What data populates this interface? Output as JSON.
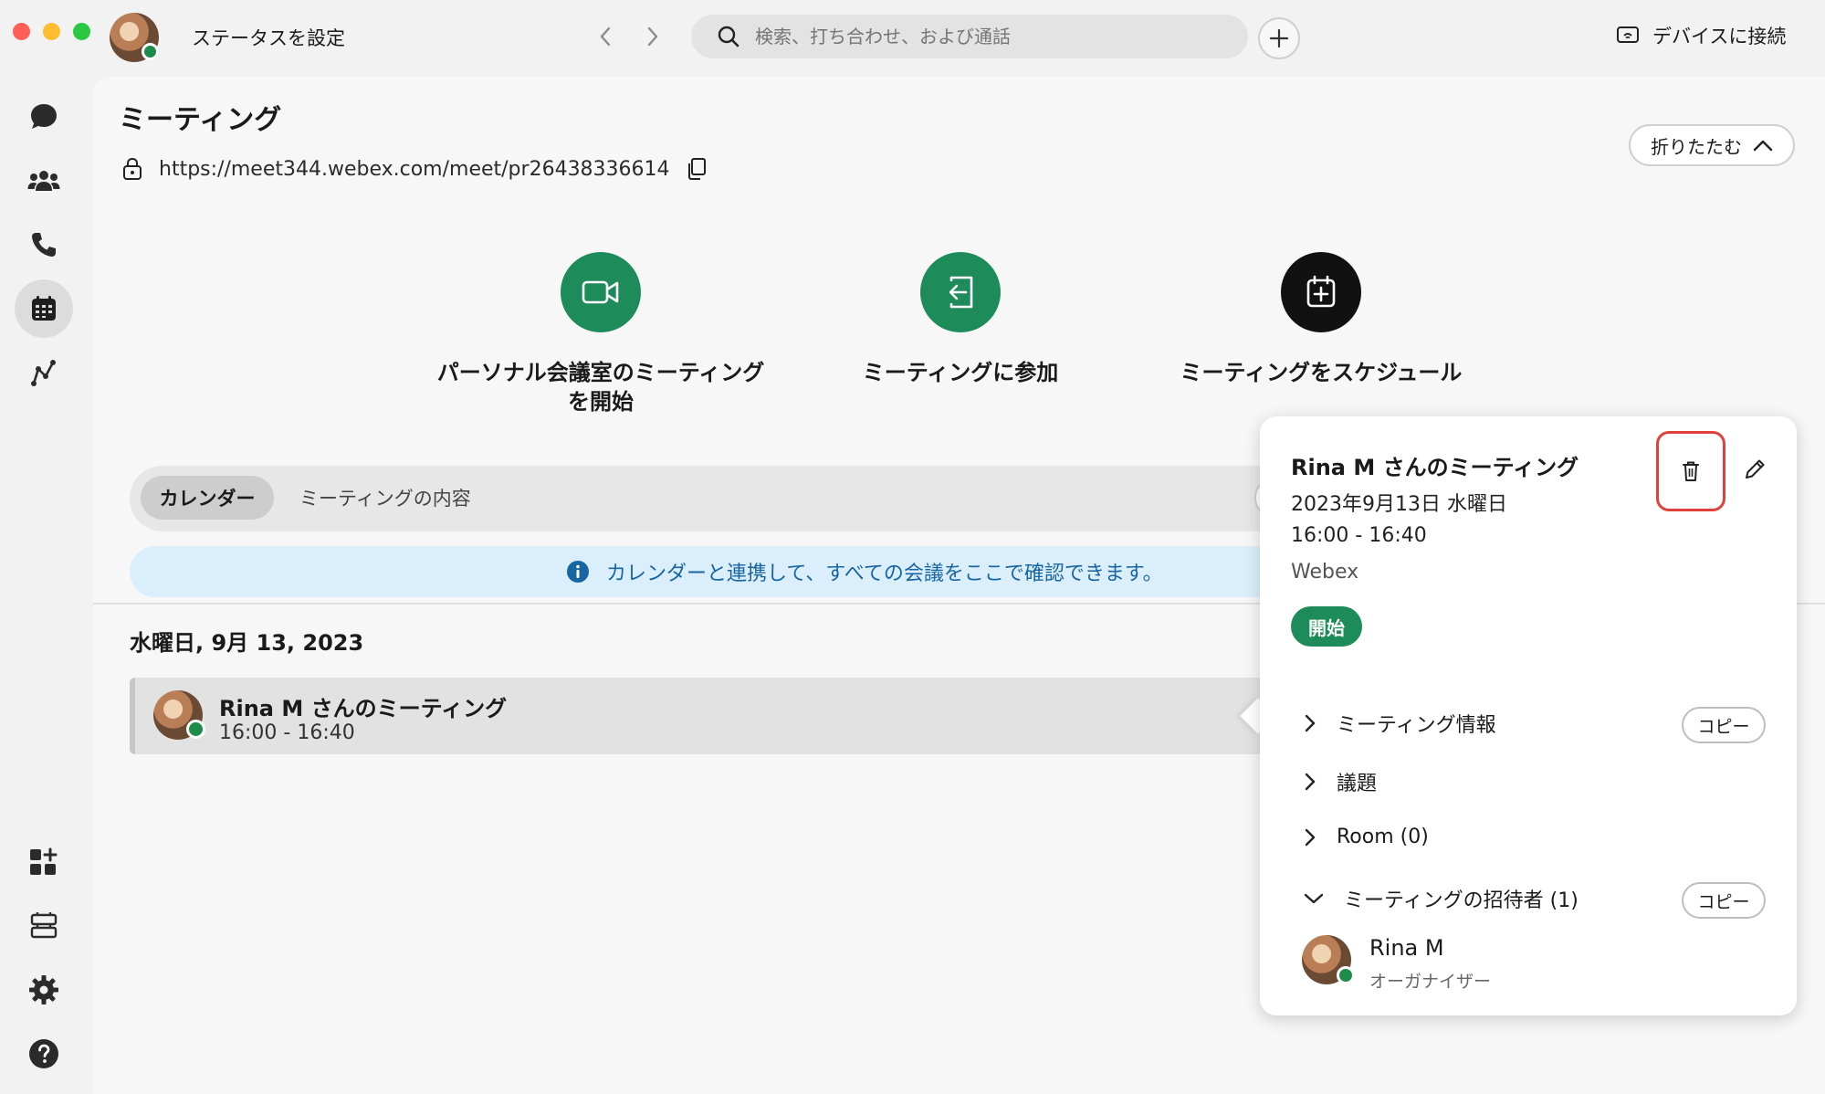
{
  "header": {
    "status_label": "ステータスを設定",
    "search_placeholder": "検索、打ち合わせ、および通話",
    "connect_device": "デバイスに接続"
  },
  "sidebar": {
    "items": [
      {
        "icon": "chat-icon",
        "active": false
      },
      {
        "icon": "teams-icon",
        "active": false
      },
      {
        "icon": "phone-icon",
        "active": false
      },
      {
        "icon": "calendar-icon",
        "active": true
      },
      {
        "icon": "analytics-icon",
        "active": false
      },
      {
        "icon": "apps-icon",
        "active": false
      },
      {
        "icon": "devices-icon",
        "active": false
      },
      {
        "icon": "gear-icon",
        "active": false
      },
      {
        "icon": "help-icon",
        "active": false
      }
    ]
  },
  "main": {
    "title": "ミーティング",
    "url": "https://meet344.webex.com/meet/pr26438336614",
    "collapse_label": "折りたたむ",
    "actions": [
      {
        "label": "パーソナル会議室のミーティングを開始",
        "color": "#1d8c5a"
      },
      {
        "label": "ミーティングに参加",
        "color": "#1d8c5a"
      },
      {
        "label": "ミーティングをスケジュール",
        "color": "#111111"
      }
    ],
    "tabs": {
      "calendar": "カレンダー",
      "content": "ミーティングの内容"
    },
    "banner": "カレンダーと連携して、すべての会議をここで確認できます。",
    "date_heading": "水曜日, 9月 13, 2023",
    "meeting": {
      "title": "Rina M さんのミーティング",
      "time": "16:00 - 16:40"
    }
  },
  "popover": {
    "title": "Rina M さんのミーティング",
    "date": "2023年9月13日 水曜日",
    "time": "16:00 - 16:40",
    "platform": "Webex",
    "start_label": "開始",
    "sections": {
      "info": "ミーティング情報",
      "agenda": "議題",
      "room": "Room (0)",
      "invitees": "ミーティングの招待者 (1)"
    },
    "copy_label": "コピー",
    "invitee": {
      "name": "Rina M",
      "role": "オーガナイザー"
    }
  },
  "colors": {
    "accent_green": "#1d8c5a",
    "delete_highlight": "#e0413a",
    "banner_bg": "#dbeefb",
    "banner_text": "#1766a3"
  }
}
